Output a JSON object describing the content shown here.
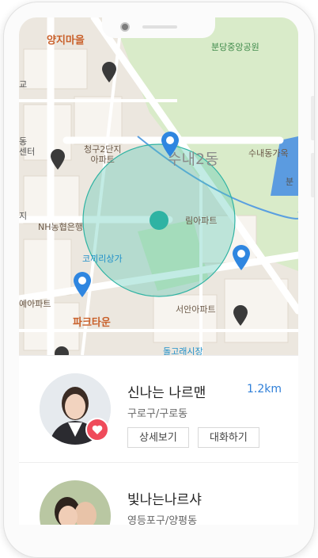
{
  "map": {
    "labels": {
      "yangji": "양지마을",
      "park": "분당중앙공원",
      "gyo": "교",
      "dong_center": "동\n센터",
      "cheonggu": "청구2단지\n아파트",
      "sunae_dong": "수내2동",
      "sunae_gaok": "수내동가옥",
      "bun": "분",
      "ji": "지",
      "nh_bank": "NH농협은행",
      "rim_apt": "림아파트",
      "kokiri": "코끼리상가",
      "ye_apt": "예아파트",
      "seoan_apt": "서안아파트",
      "park_town": "파크타운",
      "dolgorae": "돌고래시장"
    },
    "colors": {
      "radius_fill": "#4fc6b3",
      "center_dot": "#2fb3a3",
      "pin_blue": "#2f86e0",
      "pin_dark": "#3a3a3a"
    }
  },
  "users": [
    {
      "name": "신나는 나르맨",
      "distance": "1.2km",
      "location": "구로구/구로동",
      "detail_label": "상세보기",
      "chat_label": "대화하기",
      "favorited": true
    },
    {
      "name": "빛나는나르샤",
      "location": "영등포구/양평동"
    }
  ]
}
